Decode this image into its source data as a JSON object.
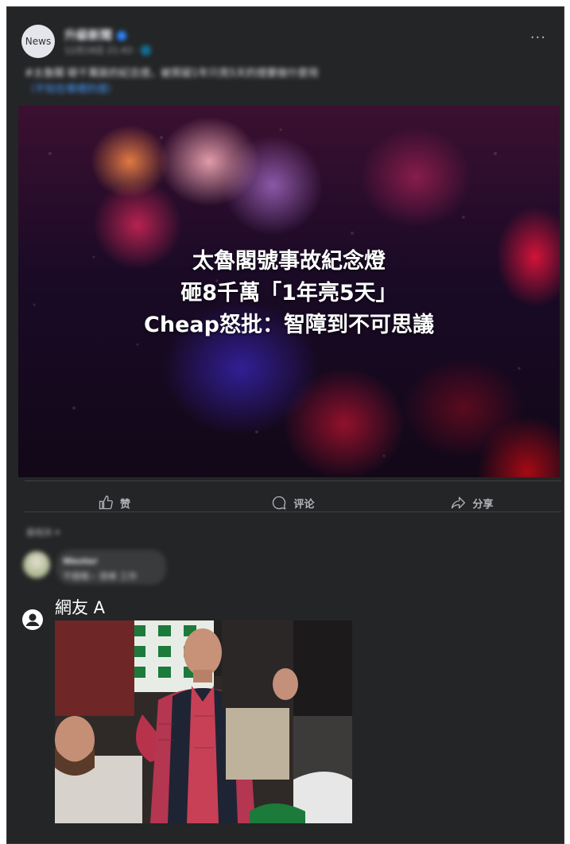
{
  "post": {
    "avatar_text": "News",
    "page_name": "升級新聞",
    "time": "12月18日 21:43 · 🌐",
    "text": "#太魯閣 砸千萬裝的紀念燈，被質疑1年只亮5天的燈要做什麼用",
    "text_line2": "（不知在哪裡的燈）",
    "headline": [
      "太魯閣號事故紀念燈",
      "砸8千萬「1年亮5天」",
      "Cheap怒批：智障到不可思議"
    ]
  },
  "actions": {
    "like": "赞",
    "comment": "评论",
    "share": "分享"
  },
  "comments": {
    "sort_label": "最相关 ▾",
    "first_name": "Wester",
    "first_text": "不錯喔~ 很棒 工作",
    "netizen_name": "網友 A"
  },
  "meme": {
    "flag_color": "#1c7a3a",
    "shirt_color": "#c33b55",
    "vest_color": "#1e2433"
  }
}
